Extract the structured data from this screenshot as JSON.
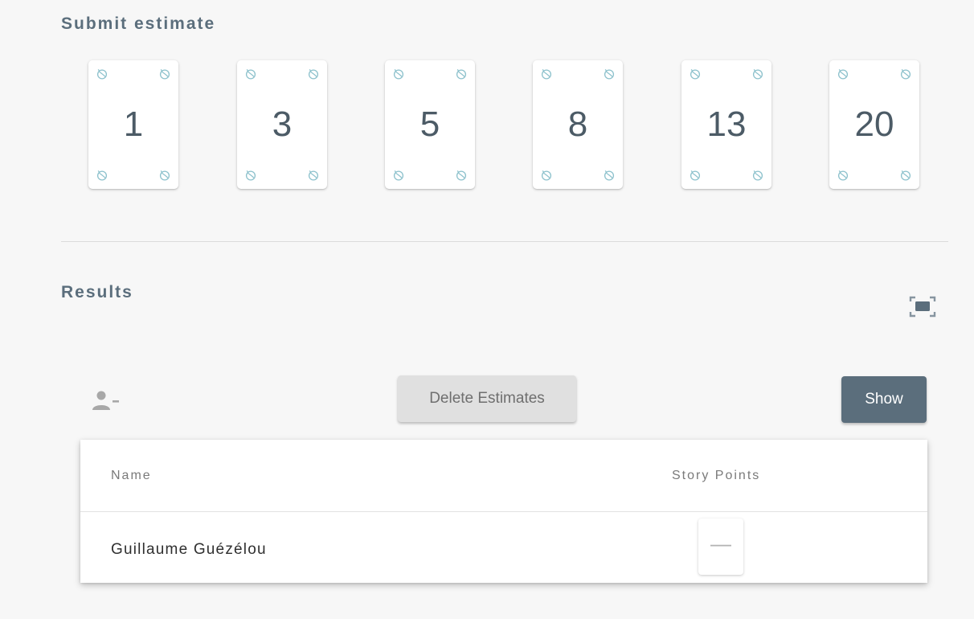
{
  "submit_section": {
    "title": "Submit estimate",
    "cards": [
      {
        "value": "1"
      },
      {
        "value": "3"
      },
      {
        "value": "5"
      },
      {
        "value": "8"
      },
      {
        "value": "13"
      },
      {
        "value": "20"
      }
    ],
    "card_corner_icon": "coffee-bean-icon"
  },
  "results_section": {
    "title": "Results",
    "fullscreen_icon": "fullscreen-icon",
    "remove_user_icon": "remove-user-icon",
    "delete_button_label": "Delete Estimates",
    "show_button_label": "Show",
    "table": {
      "columns": [
        "Name",
        "Story Points"
      ],
      "rows": [
        {
          "name": "Guillaume Guézélou",
          "points": "—"
        }
      ]
    }
  },
  "colors": {
    "accent": "#5b6e7c",
    "background": "#f7f7f7",
    "icon_teal": "#8cc1cc"
  }
}
